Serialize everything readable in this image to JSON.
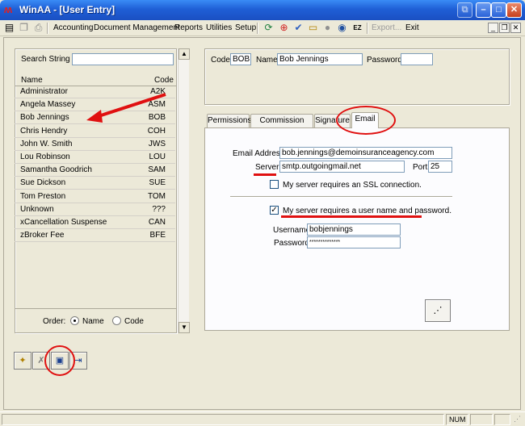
{
  "window": {
    "title": "WinAA - [User Entry]",
    "logo_glyph": "ʍ"
  },
  "menu": {
    "items": [
      "Accounting",
      "Document Management",
      "Reports",
      "Utilities",
      "Setup"
    ],
    "export_label": "Export...",
    "exit_label": "Exit"
  },
  "search": {
    "label": "Search String >",
    "value": ""
  },
  "list": {
    "col_name": "Name",
    "col_code": "Code",
    "rows": [
      {
        "name": "Administrator",
        "code": "A2K"
      },
      {
        "name": "Angela Massey",
        "code": "ASM"
      },
      {
        "name": "Bob Jennings",
        "code": "BOB"
      },
      {
        "name": "Chris Hendry",
        "code": "COH"
      },
      {
        "name": "John W. Smith",
        "code": "JWS"
      },
      {
        "name": "Lou Robinson",
        "code": "LOU"
      },
      {
        "name": "Samantha Goodrich",
        "code": "SAM"
      },
      {
        "name": "Sue Dickson",
        "code": "SUE"
      },
      {
        "name": "Tom Preston",
        "code": "TOM"
      },
      {
        "name": "Unknown",
        "code": "???"
      },
      {
        "name": "xCancellation Suspense",
        "code": "CAN"
      },
      {
        "name": "zBroker Fee",
        "code": "BFE"
      }
    ]
  },
  "order": {
    "label": "Order:",
    "name_label": "Name",
    "code_label": "Code",
    "selected": "Name"
  },
  "user": {
    "code_label": "Code",
    "code_value": "BOB",
    "name_label": "Name",
    "name_value": "Bob Jennings",
    "password_label": "Password",
    "password_value": ""
  },
  "tabs": [
    "Permissions",
    "Commission Rates",
    "Signature",
    "Email"
  ],
  "active_tab": "Email",
  "email": {
    "address_label": "Email Address",
    "address_value": "bob.jennings@demoinsuranceagency.com",
    "server_label": "Server",
    "server_value": "smtp.outgoingmail.net",
    "port_label": "Port",
    "port_value": "25",
    "ssl_label": "My server requires an SSL connection.",
    "ssl_checked": false,
    "auth_label": "My server requires a user name and password.",
    "auth_checked": true,
    "username_label": "Username",
    "username_value": "bobjennings",
    "password_label": "Password",
    "password_value": "**************"
  },
  "status": {
    "num": "NUM"
  },
  "colors": {
    "annotation_red": "#e01010",
    "title_blue": "#1f5fd6"
  }
}
